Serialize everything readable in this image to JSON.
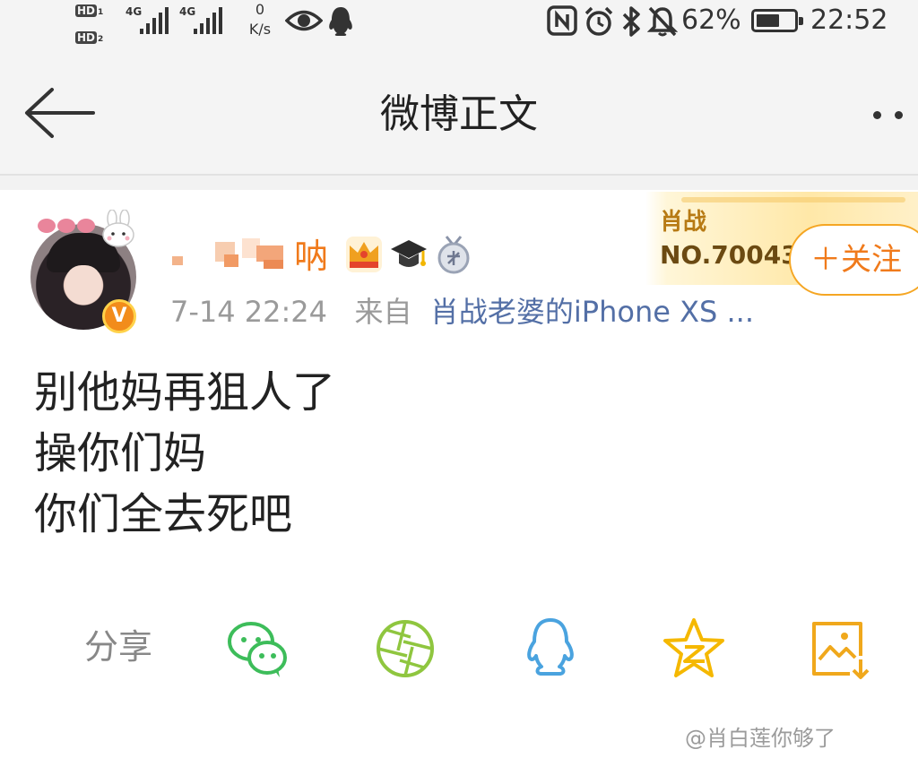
{
  "status_bar": {
    "hd1": "HD",
    "hd1_sub": "1",
    "hd2": "HD",
    "hd2_sub": "2",
    "signal1_label": "4G",
    "signal2_label": "4G",
    "net_speed_value": "0",
    "net_speed_unit": "K/s",
    "icons": [
      "eye-icon",
      "qq-icon",
      "nfc-icon",
      "alarm-icon",
      "bluetooth-icon",
      "mute-icon"
    ],
    "battery_text": "62%",
    "battery_level": 0.62,
    "time": "22:52"
  },
  "nav": {
    "title": "微博正文"
  },
  "post": {
    "username_visible": "呐",
    "timestamp": "7-14 22:24",
    "source_prefix": "来自",
    "source": "肖战老婆的iPhone XS ...",
    "fan_badge": {
      "name": "肖战",
      "number": "NO.700439"
    },
    "follow_label": "＋关注",
    "lines": [
      "别他妈再狙人了",
      "操你们妈",
      "你们全去死吧"
    ]
  },
  "share": {
    "label": "分享",
    "targets": [
      "wechat-icon",
      "moments-icon",
      "qq-icon",
      "qzone-icon",
      "save-image-icon"
    ]
  },
  "watermark": "@肖白莲你够了",
  "colors": {
    "accent_orange": "#f07a1b",
    "source_blue": "#536fa6",
    "wechat_green": "#3dbd5a",
    "moments_green": "#8fc63f",
    "qq_blue": "#4aa3df",
    "qzone_yellow": "#f5b800"
  }
}
